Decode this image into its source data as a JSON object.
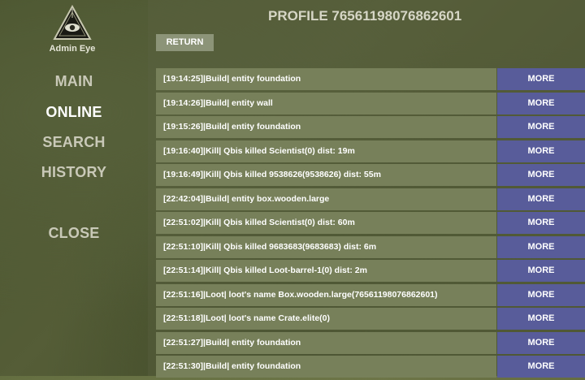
{
  "app": {
    "logo_label": "Admin Eye",
    "title": "PROFILE 76561198076862601"
  },
  "nav": {
    "main": "MAIN",
    "online": "ONLINE",
    "search": "SEARCH",
    "history": "HISTORY",
    "close": "CLOSE"
  },
  "return_label": "RETURN",
  "more_label": "MORE",
  "logs": [
    "[19:14:25]|Build| entity foundation",
    "[19:14:26]|Build| entity wall",
    "[19:15:26]|Build| entity foundation",
    "[19:16:40]|Kill| Qbis killed Scientist(0) dist: 19m",
    "[19:16:49]|Kill| Qbis killed 9538626(9538626) dist: 55m",
    "[22:42:04]|Build| entity box.wooden.large",
    "[22:51:02]|Kill| Qbis killed Scientist(0) dist: 60m",
    "[22:51:10]|Kill| Qbis killed 9683683(9683683) dist: 6m",
    "[22:51:14]|Kill| Qbis killed Loot-barrel-1(0) dist: 2m",
    "[22:51:16]|Loot| loot's name Box.wooden.large(76561198076862601)",
    "[22:51:18]|Loot| loot's name Crate.elite(0)",
    "[22:51:27]|Build| entity foundation",
    "[22:51:30]|Build| entity foundation"
  ],
  "colors": {
    "row_bg": "#77805a",
    "more_bg": "#585c9a",
    "return_bg": "#8c9478"
  },
  "icons": {
    "logo": "all-seeing-eye-icon"
  }
}
